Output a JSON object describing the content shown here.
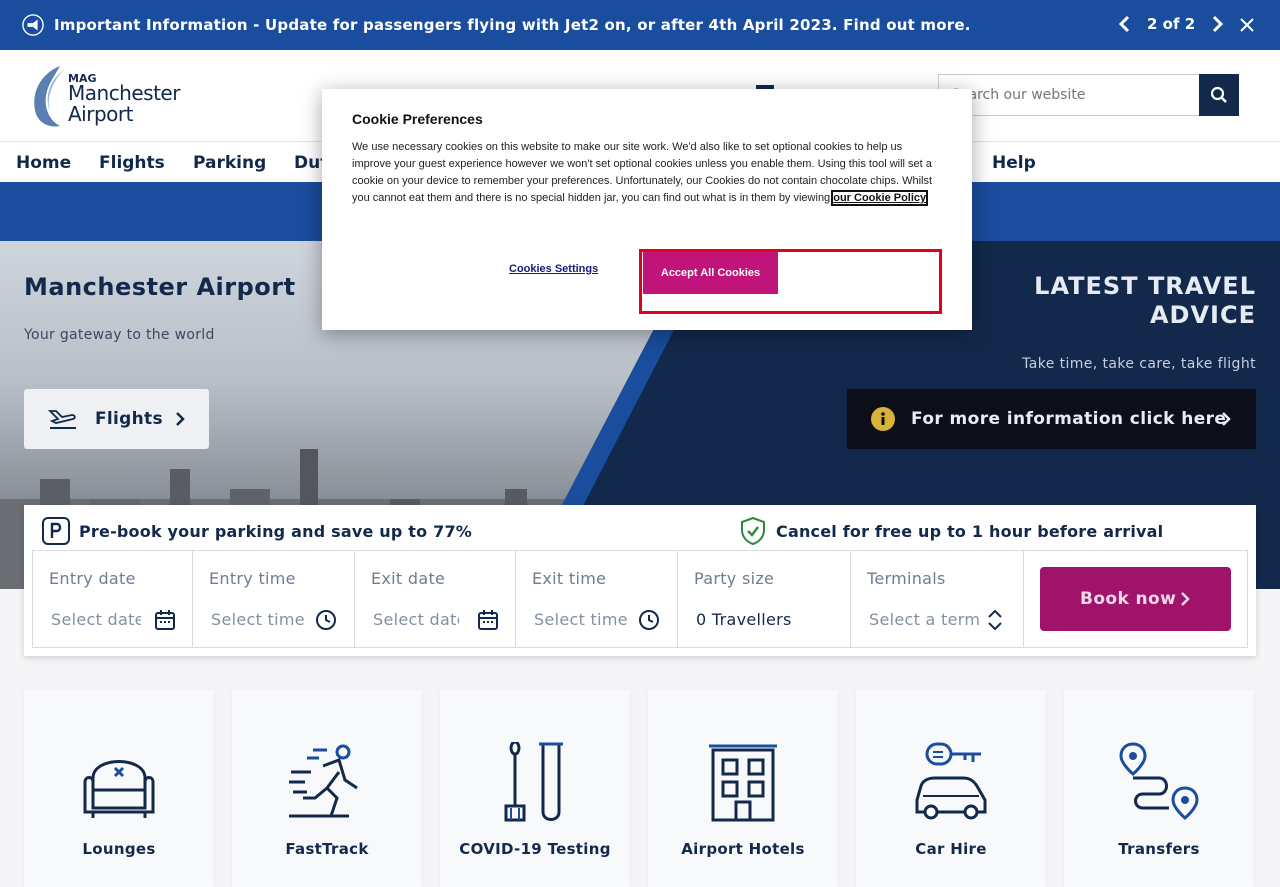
{
  "announcement": {
    "message": "Important Information - Update for passengers flying with Jet2 on, or after 4th April 2023. Find out more.",
    "pager": "2 of 2"
  },
  "header": {
    "logo": {
      "prefix": "MAG",
      "line1": "Manchester",
      "line2": "Airport"
    },
    "search_placeholder": "Search our website"
  },
  "nav": {
    "items": [
      "Home",
      "Flights",
      "Parking",
      "Duty Free",
      "Help"
    ]
  },
  "hero": {
    "title": "Manchester Airport",
    "subtitle": "Your gateway to the world",
    "flights_button": "Flights",
    "advice_title_line1": "LATEST TRAVEL",
    "advice_title_line2": "ADVICE",
    "advice_subtitle": "Take time, take care, take flight",
    "advice_button": "For more information click here"
  },
  "booking": {
    "promo_left": "Pre-book your parking and save up to 77%",
    "promo_right": "Cancel for free up to 1 hour before arrival",
    "fields": [
      {
        "label": "Entry date",
        "value": "Select date"
      },
      {
        "label": "Entry time",
        "value": "Select time"
      },
      {
        "label": "Exit date",
        "value": "Select date"
      },
      {
        "label": "Exit time",
        "value": "Select time"
      },
      {
        "label": "Party size",
        "value": "0 Travellers"
      },
      {
        "label": "Terminals",
        "value": "Select a terminal"
      }
    ],
    "book_button": "Book now"
  },
  "tiles": [
    "Lounges",
    "FastTrack",
    "COVID-19 Testing",
    "Airport Hotels",
    "Car Hire",
    "Transfers"
  ],
  "cookie": {
    "title": "Cookie Preferences",
    "body": "We use necessary cookies on this website to make our site work. We'd also like to set optional cookies to help us improve your guest experience however we won't set optional cookies unless you enable them. Using this tool will set a cookie on your device to remember your preferences. Unfortunately, our Cookies do not contain chocolate chips. Whilst you cannot eat them and there is no special hidden jar, you can find out what is in them by viewing ",
    "link": "our Cookie Policy",
    "settings_button": "Cookies Settings",
    "accept_button": "Accept All Cookies"
  },
  "colors": {
    "navy": "#13294b",
    "blue": "#1a4d9e",
    "magenta": "#a0136b",
    "highlight": "#e3001b"
  }
}
